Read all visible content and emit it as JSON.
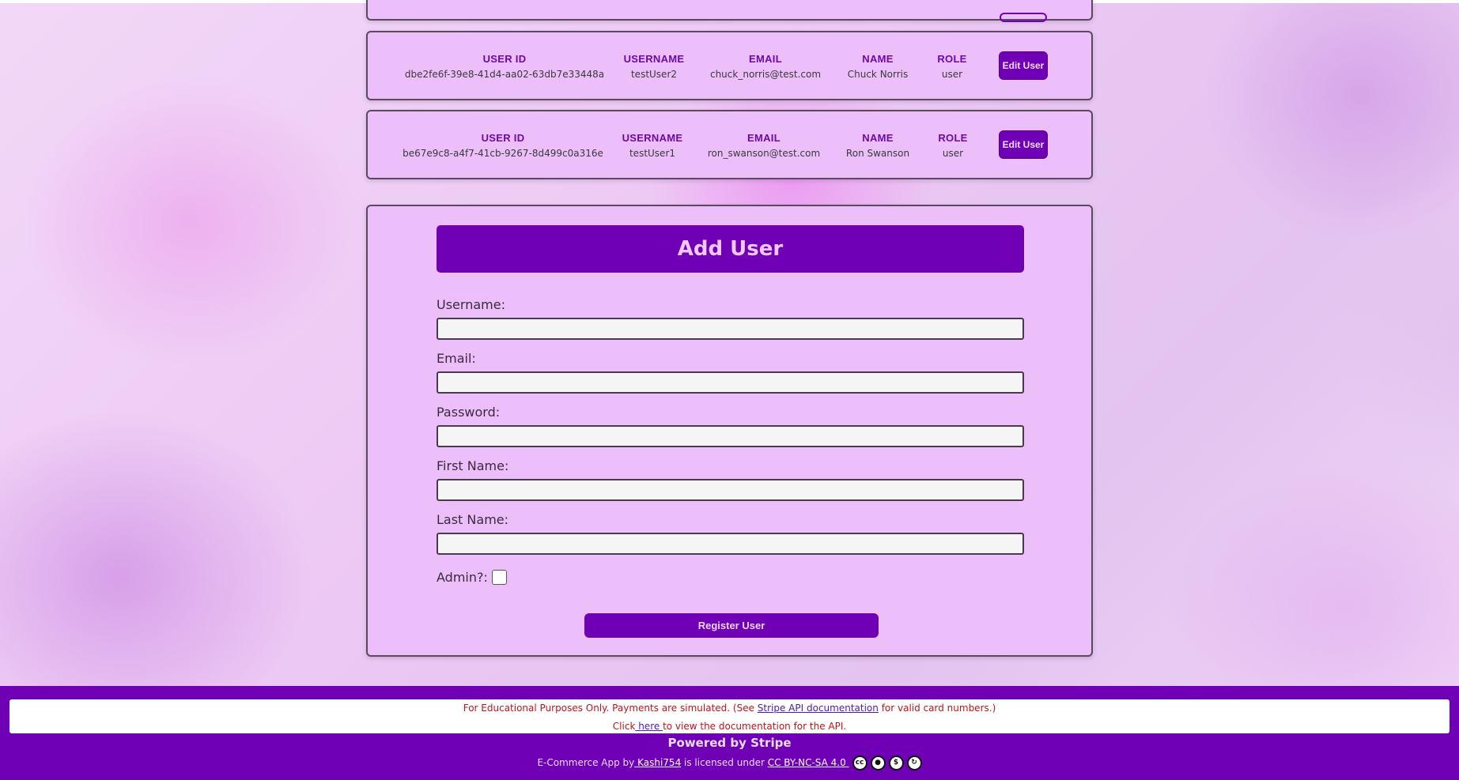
{
  "users": [
    {
      "headers": {
        "id": "USER ID",
        "username": "USERNAME",
        "email": "EMAIL",
        "name": "NAME",
        "role": "ROLE"
      },
      "id": "dbe2fe6f-39e8-41d4-aa02-63db7e33448a",
      "username": "testUser2",
      "email": "chuck_norris@test.com",
      "name": "Chuck Norris",
      "role": "user",
      "edit_label": "Edit User"
    },
    {
      "headers": {
        "id": "USER ID",
        "username": "USERNAME",
        "email": "EMAIL",
        "name": "NAME",
        "role": "ROLE"
      },
      "id": "be67e9c8-a4f7-41cb-9267-8d499c0a316e",
      "username": "testUser1",
      "email": "ron_swanson@test.com",
      "name": "Ron Swanson",
      "role": "user",
      "edit_label": "Edit User"
    }
  ],
  "add_user": {
    "title": "Add User",
    "username_label": "Username:",
    "email_label": "Email:",
    "password_label": "Password:",
    "first_name_label": "First Name:",
    "last_name_label": "Last Name:",
    "admin_label": "Admin?:",
    "register_label": "Register User",
    "username_value": "",
    "email_value": "",
    "password_value": "",
    "first_name_value": "",
    "last_name_value": ""
  },
  "footer": {
    "notice_prefix": "For Educational Purposes Only. Payments are simulated. (See ",
    "notice_link": "Stripe API documentation",
    "notice_suffix": " for valid card numbers.)",
    "click_prefix": "Click",
    "click_link": " here ",
    "click_suffix": "to view the documentation for the API.",
    "powered": "Powered by Stripe",
    "license_prefix": "E-Commerce App by",
    "author_link": " Kashi754",
    "license_mid": " is licensed under ",
    "license_link": "CC BY-NC-SA 4.0 ",
    "cc_icons": [
      "cc-icon",
      "by-icon",
      "nc-icon",
      "sa-icon"
    ]
  },
  "colors": {
    "accent": "#7000b6",
    "card_bg": "#ecbffb",
    "notice_text": "#c0131a"
  }
}
